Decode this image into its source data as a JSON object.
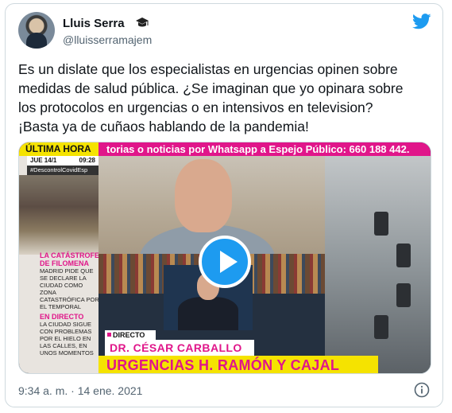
{
  "tweet": {
    "author_name": "Lluis Serra",
    "handle": "@lluisserramajem",
    "text_lines": [
      "Es un dislate que los especialistas en urgencias opinen sobre",
      "medidas de salud pública. ¿Se imaginan que yo opinara sobre",
      "los protocolos en urgencias o en intensivos en television?",
      "¡Basta ya de cuñaos hablando de la pandemia!"
    ],
    "timestamp": "9:34 a. m. · 14 ene. 2021"
  },
  "video": {
    "ultima_hora": "ÚLTIMA HORA",
    "ticker": "torias o noticias por Whatsapp a Espejo Público: 660 188 442.",
    "date": "JUE 14/1",
    "time": "09:28",
    "hashtag": "#DescontrolCovidEsp",
    "side_title": "LA CATÁSTROFE DE FILOMENA",
    "side_text1": "MADRID PIDE QUE SE DECLARE LA CIUDAD COMO ZONA CATASTRÓFICA POR EL TEMPORAL",
    "side_title2": "EN DIRECTO",
    "side_text2": "LA CIUDAD SIGUE CON PROBLEMAS POR EL HIELO EN LAS CALLES, EN UNOS MOMENTOS",
    "directo": "DIRECTO",
    "doctor": "DR. CÉSAR CARBALLO",
    "hospital": "URGENCIAS H. RAMÓN Y CAJAL"
  },
  "colors": {
    "twitter_blue": "#1d9bf0",
    "ticker_pink": "#e0168a",
    "banner_yellow": "#f5e300"
  },
  "icons": [
    "graduation-cap-icon",
    "twitter-bird-icon",
    "play-icon",
    "info-icon"
  ]
}
